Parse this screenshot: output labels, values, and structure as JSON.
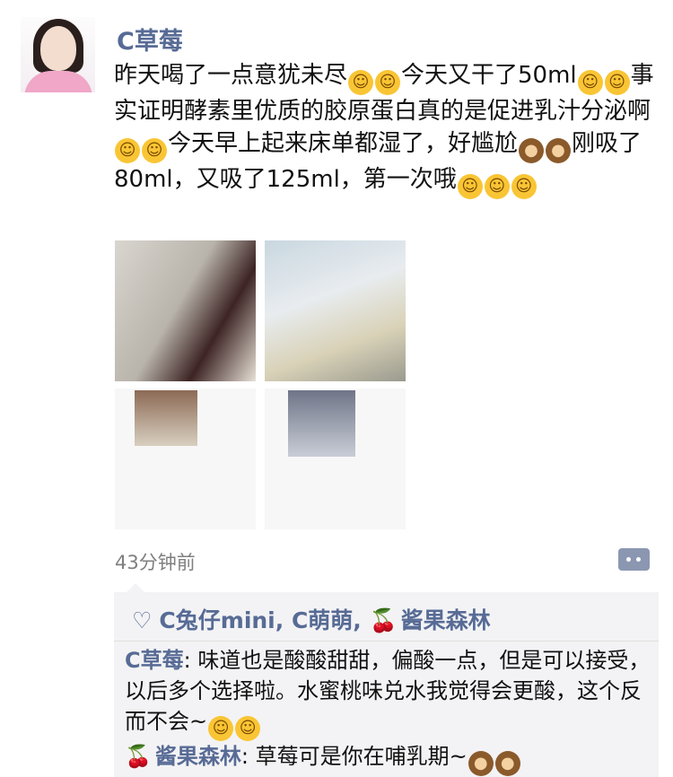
{
  "post": {
    "author": "C草莓",
    "text_parts": [
      "昨天喝了一点意犹未尽",
      "今天又干了50ml",
      "事实证明酵素里优质的胶原蛋白真的是促进乳汁分泌啊",
      "今天早上起来床单都湿了，好尴尬",
      "刚吸了80ml，又吸了125ml，第一次哦"
    ],
    "time": "43分钟前"
  },
  "likes": {
    "names": "C兔仔mini, C萌萌, ",
    "last_name": "酱果森林"
  },
  "comments": [
    {
      "author": "C草莓",
      "sep": ": ",
      "text": "味道也是酸酸甜甜，偏酸一点，但是可以接受，以后多个选择啦。水蜜桃味兑水我觉得会更酸，这个反而不会~"
    },
    {
      "author": "酱果森林",
      "sep": ": ",
      "text": "草莓可是你在哺乳期~"
    }
  ],
  "icons": {
    "avatar": "avatar",
    "yum_emoji": "yum-emoji",
    "blush_emoji": "flushed-emoji",
    "wink_emoji": "wink-emoji",
    "monkey_emoji": "see-no-evil-emoji",
    "hug_emoji": "hug-emoji",
    "heart": "heart-icon",
    "cherry": "cherry-icon",
    "comment": "comment-icon"
  }
}
